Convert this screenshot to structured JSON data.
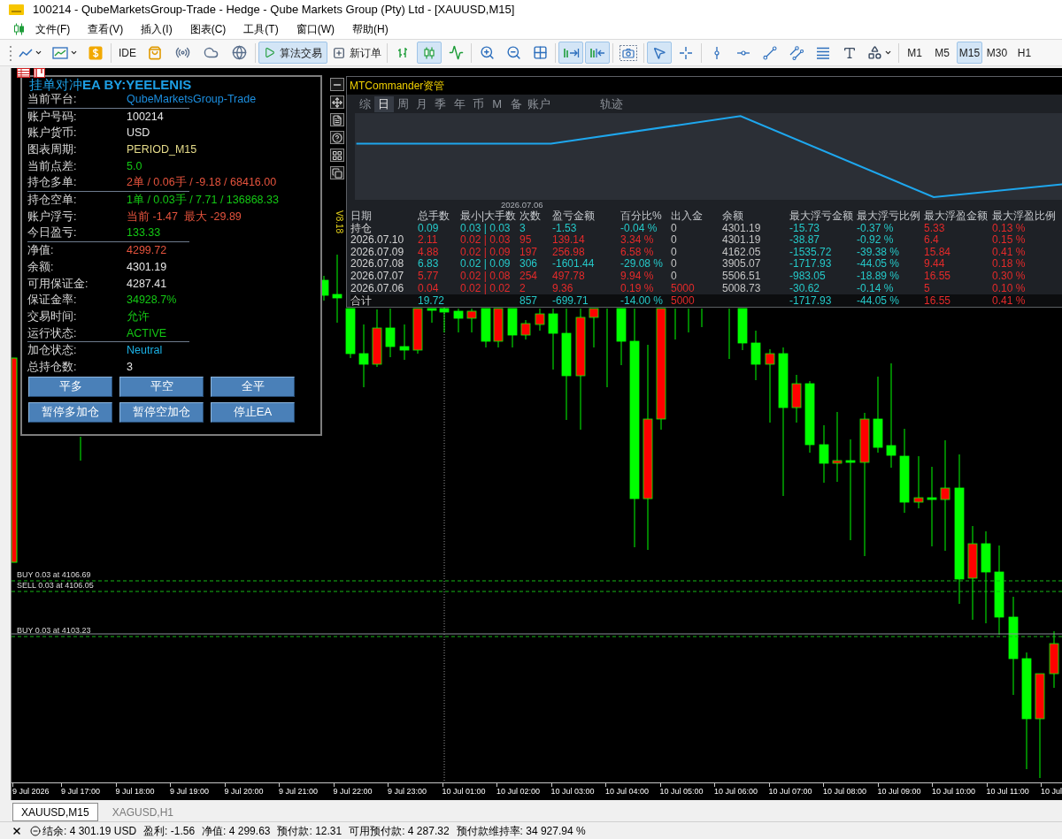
{
  "window": {
    "title": "100214 - QubeMarketsGroup-Trade - Hedge - Qube Markets Group (Pty) Ltd - [XAUUSD,M15]"
  },
  "menu": [
    "文件(F)",
    "查看(V)",
    "插入(I)",
    "图表(C)",
    "工具(T)",
    "窗口(W)",
    "帮助(H)"
  ],
  "toolbar": {
    "ide": "IDE",
    "algo_trading": {
      "label": "算法交易",
      "on": true
    },
    "new_order": {
      "label": "新订单"
    },
    "chart_types": [
      {
        "selected": false
      },
      {
        "selected": true
      },
      {
        "selected": false
      }
    ],
    "auto_scroll": {
      "on": true
    },
    "chart_shift": {
      "on": true
    },
    "pointer_tools": [
      {
        "selected": true
      },
      {
        "selected": false
      }
    ],
    "timeframes": [
      {
        "label": "M1",
        "selected": false
      },
      {
        "label": "M5",
        "selected": false
      },
      {
        "label": "M15",
        "selected": true
      },
      {
        "label": "M30",
        "selected": false
      },
      {
        "label": "H1",
        "selected": false
      }
    ]
  },
  "ea_panel": {
    "title": "挂单对冲**EA BY:YEELENIS**",
    "sections": [
      [
        {
          "label": "当前平台:",
          "value": "QubeMarketsGroup-Trade",
          "color": "#1c8fe0"
        }
      ],
      [
        {
          "label": "账户号码:",
          "value": "100214",
          "color": "#e6e6e6"
        },
        {
          "label": "账户货币:",
          "value": "USD",
          "color": "#e6e6e6"
        },
        {
          "label": "图表周期:",
          "value": "PERIOD_M15",
          "color": "#e6dc8a"
        },
        {
          "label": "当前点差:",
          "value": "5.0",
          "color": "#14c814"
        },
        {
          "label": "持仓多单:",
          "value": "2单 / 0.06手 / -9.18 / 68416.00",
          "color": "#e5533d"
        }
      ],
      [
        {
          "label": "持仓空单:",
          "value": "1单 / 0.03手 / 7.71 / 136868.33",
          "color": "#14c814"
        },
        {
          "label": "账户浮亏:",
          "value": "当前 -1.47  最大 -29.89",
          "color": "#e5533d"
        },
        {
          "label": "今日盈亏:",
          "value": "133.33",
          "color": "#14c814"
        }
      ],
      [
        {
          "label": "净值:",
          "value": "4299.72",
          "color": "#e5533d"
        },
        {
          "label": "余额:",
          "value": "4301.19",
          "color": "#e6e6e6"
        },
        {
          "label": "可用保证金:",
          "value": "4287.41",
          "color": "#e6e6e6"
        },
        {
          "label": "保证金率:",
          "value": "34928.7%",
          "color": "#14c814"
        },
        {
          "label": "交易时间:",
          "value": "允许",
          "color": "#14c814"
        },
        {
          "label": "运行状态:",
          "value": "ACTIVE",
          "color": "#14c814"
        }
      ],
      [
        {
          "label": "加仓状态:",
          "value": "Neutral",
          "color": "#1ab0e4"
        },
        {
          "label": "总持仓数:",
          "value": "3",
          "color": "#e6e6e6"
        }
      ]
    ],
    "buttons": [
      [
        "平多",
        "平空",
        "全平"
      ],
      [
        "暂停多加仓",
        "暂停空加仓",
        "停止EA"
      ]
    ]
  },
  "commander": {
    "title": "MTCommander资管",
    "version": "V8.18",
    "tabs": [
      {
        "label": "综",
        "selected": false
      },
      {
        "label": "日",
        "selected": true
      },
      {
        "label": "周",
        "selected": false
      },
      {
        "label": "月",
        "selected": false
      },
      {
        "label": "季",
        "selected": false
      },
      {
        "label": "年",
        "selected": false
      },
      {
        "label": "币",
        "selected": false
      },
      {
        "label": "M",
        "selected": false
      },
      {
        "label": "备",
        "selected": false
      },
      {
        "label": "账户",
        "selected": false
      },
      {
        "label": "轨迹",
        "selected": false
      }
    ],
    "chart_date": "2026.07.06",
    "columns": [
      "日期",
      "总手数",
      "最小|大手数",
      "次数",
      "盈亏金额",
      "百分比%",
      "出入金",
      "余额",
      "最大浮亏金额",
      "最大浮亏比例",
      "最大浮盈金额",
      "最大浮盈比例"
    ],
    "rows": [
      {
        "cells": [
          {
            "text": "持仓"
          },
          {
            "text": "0.09",
            "color": "#25c9c9"
          },
          {
            "text": "0.03 | 0.03",
            "color": "#25c9c9"
          },
          {
            "text": "3",
            "color": "#25c9c9"
          },
          {
            "text": "-1.53",
            "color": "#25c9c9"
          },
          {
            "text": "-0.04 %",
            "color": "#25c9c9"
          },
          {
            "text": "0",
            "color": "#c4c4c4"
          },
          {
            "text": "4301.19",
            "color": "#c4c4c4"
          },
          {
            "text": "-15.73",
            "color": "#25c9c9"
          },
          {
            "text": "-0.37 %",
            "color": "#25c9c9"
          },
          {
            "text": "5.33",
            "color": "#e42a2a"
          },
          {
            "text": "0.13 %",
            "color": "#e42a2a"
          }
        ]
      },
      {
        "cells": [
          {
            "text": "2026.07.10"
          },
          {
            "text": "2.11",
            "color": "#e42a2a"
          },
          {
            "text": "0.02 | 0.03",
            "color": "#e42a2a"
          },
          {
            "text": "95",
            "color": "#e42a2a"
          },
          {
            "text": "139.14",
            "color": "#e42a2a"
          },
          {
            "text": "3.34 %",
            "color": "#e42a2a"
          },
          {
            "text": "0",
            "color": "#c4c4c4"
          },
          {
            "text": "4301.19",
            "color": "#c4c4c4"
          },
          {
            "text": "-38.87",
            "color": "#25c9c9"
          },
          {
            "text": "-0.92 %",
            "color": "#25c9c9"
          },
          {
            "text": "6.4",
            "color": "#e42a2a"
          },
          {
            "text": "0.15 %",
            "color": "#e42a2a"
          }
        ]
      },
      {
        "cells": [
          {
            "text": "2026.07.09"
          },
          {
            "text": "4.88",
            "color": "#e42a2a"
          },
          {
            "text": "0.02 | 0.09",
            "color": "#e42a2a"
          },
          {
            "text": "197",
            "color": "#e42a2a"
          },
          {
            "text": "256.98",
            "color": "#e42a2a"
          },
          {
            "text": "6.58 %",
            "color": "#e42a2a"
          },
          {
            "text": "0",
            "color": "#c4c4c4"
          },
          {
            "text": "4162.05",
            "color": "#c4c4c4"
          },
          {
            "text": "-1535.72",
            "color": "#25c9c9"
          },
          {
            "text": "-39.38 %",
            "color": "#25c9c9"
          },
          {
            "text": "15.84",
            "color": "#e42a2a"
          },
          {
            "text": "0.41 %",
            "color": "#e42a2a"
          }
        ]
      },
      {
        "cells": [
          {
            "text": "2026.07.08"
          },
          {
            "text": "6.83",
            "color": "#25c9c9"
          },
          {
            "text": "0.02 | 0.09",
            "color": "#25c9c9"
          },
          {
            "text": "306",
            "color": "#25c9c9"
          },
          {
            "text": "-1601.44",
            "color": "#25c9c9"
          },
          {
            "text": "-29.08 %",
            "color": "#25c9c9"
          },
          {
            "text": "0",
            "color": "#c4c4c4"
          },
          {
            "text": "3905.07",
            "color": "#c4c4c4"
          },
          {
            "text": "-1717.93",
            "color": "#25c9c9"
          },
          {
            "text": "-44.05 %",
            "color": "#25c9c9"
          },
          {
            "text": "9.44",
            "color": "#e42a2a"
          },
          {
            "text": "0.18 %",
            "color": "#e42a2a"
          }
        ]
      },
      {
        "cells": [
          {
            "text": "2026.07.07"
          },
          {
            "text": "5.77",
            "color": "#e42a2a"
          },
          {
            "text": "0.02 | 0.08",
            "color": "#e42a2a"
          },
          {
            "text": "254",
            "color": "#e42a2a"
          },
          {
            "text": "497.78",
            "color": "#e42a2a"
          },
          {
            "text": "9.94 %",
            "color": "#e42a2a"
          },
          {
            "text": "0",
            "color": "#c4c4c4"
          },
          {
            "text": "5506.51",
            "color": "#c4c4c4"
          },
          {
            "text": "-983.05",
            "color": "#25c9c9"
          },
          {
            "text": "-18.89 %",
            "color": "#25c9c9"
          },
          {
            "text": "16.55",
            "color": "#e42a2a"
          },
          {
            "text": "0.30 %",
            "color": "#e42a2a"
          }
        ]
      },
      {
        "cells": [
          {
            "text": "2026.07.06"
          },
          {
            "text": "0.04",
            "color": "#e42a2a"
          },
          {
            "text": "0.02 | 0.02",
            "color": "#e42a2a"
          },
          {
            "text": "2",
            "color": "#e42a2a"
          },
          {
            "text": "9.36",
            "color": "#e42a2a"
          },
          {
            "text": "0.19 %",
            "color": "#e42a2a"
          },
          {
            "text": "5000",
            "color": "#e42a2a"
          },
          {
            "text": "5008.73",
            "color": "#c4c4c4"
          },
          {
            "text": "-30.62",
            "color": "#25c9c9"
          },
          {
            "text": "-0.14 %",
            "color": "#25c9c9"
          },
          {
            "text": "5",
            "color": "#e42a2a"
          },
          {
            "text": "0.10 %",
            "color": "#e42a2a"
          }
        ]
      }
    ],
    "total": {
      "cells": [
        {
          "text": "合计"
        },
        {
          "text": "19.72",
          "color": "#25c9c9"
        },
        null,
        {
          "text": "857",
          "color": "#25c9c9"
        },
        {
          "text": "-699.71",
          "color": "#25c9c9"
        },
        {
          "text": "-14.00 %",
          "color": "#25c9c9"
        },
        {
          "text": "5000",
          "color": "#e42a2a"
        },
        null,
        {
          "text": "-1717.93",
          "color": "#25c9c9"
        },
        {
          "text": "-44.05 %",
          "color": "#25c9c9"
        },
        {
          "text": "16.55",
          "color": "#e42a2a"
        },
        {
          "text": "0.41 %",
          "color": "#e42a2a"
        }
      ]
    }
  },
  "chart": {
    "order_lines": [
      {
        "label": "BUY 0.03 at 4106.69"
      },
      {
        "label": "SELL 0.03 at 4106.05"
      },
      {
        "label": "BUY 0.03 at 4103.23"
      }
    ],
    "time_labels": [
      "9 Jul 2026",
      "9 Jul 17:00",
      "9 Jul 18:00",
      "9 Jul 19:00",
      "9 Jul 20:00",
      "9 Jul 21:00",
      "9 Jul 22:00",
      "9 Jul 23:00",
      "10 Jul 01:00",
      "10 Jul 02:00",
      "10 Jul 03:00",
      "10 Jul 04:00",
      "10 Jul 05:00",
      "10 Jul 06:00",
      "10 Jul 07:00",
      "10 Jul 08:00",
      "10 Jul 09:00",
      "10 Jul 10:00",
      "10 Jul 11:00",
      "10 Jul"
    ]
  },
  "chart_tabs": [
    {
      "label": "XAUUSD,M15",
      "selected": true
    },
    {
      "label": "XAGUSD,H1",
      "selected": false
    }
  ],
  "status_bar": {
    "items": [
      "结余: 4 301.19 USD",
      "盈利: -1.56",
      "净值: 4 299.63",
      "预付款: 12.31",
      "可用预付款: 4 287.32",
      "预付款维持率: 34 927.94 %"
    ]
  }
}
